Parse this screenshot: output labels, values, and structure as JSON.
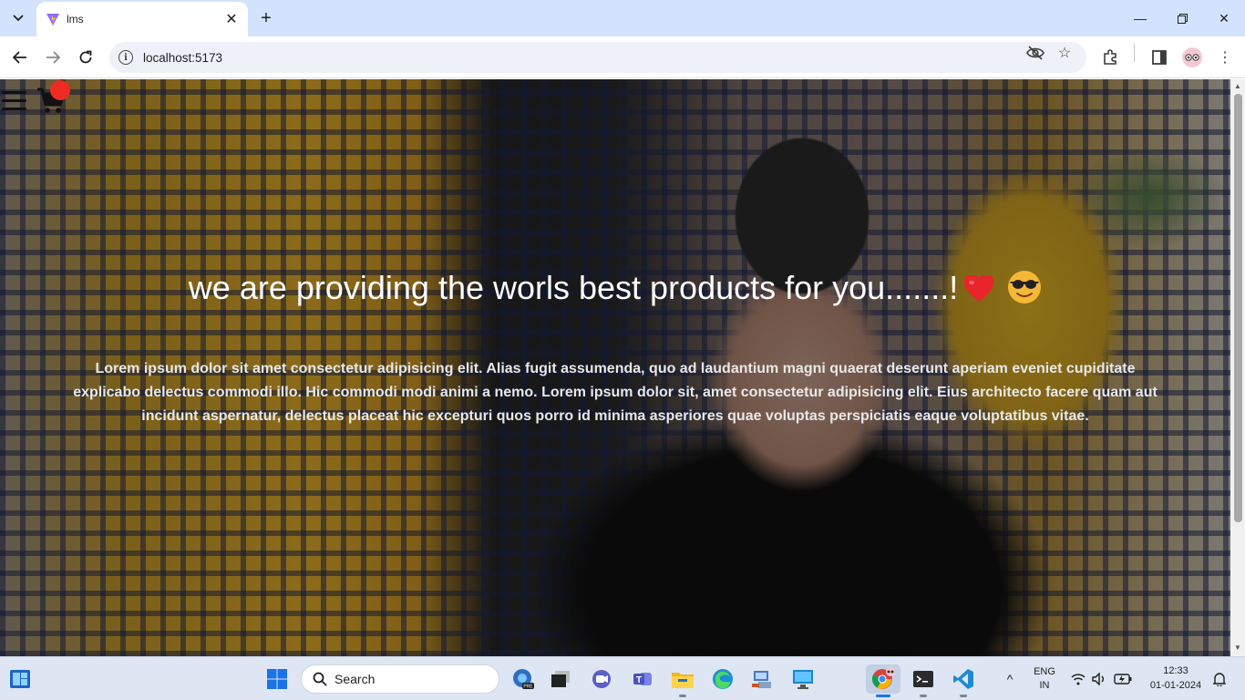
{
  "browser": {
    "tab_title": "lms",
    "url": "localhost:5173"
  },
  "page": {
    "headline": "we are providing the worls best products for you.......!",
    "body": "Lorem ipsum dolor sit amet consectetur adipisicing elit. Alias fugit assumenda, quo ad laudantium magni quaerat deserunt aperiam eveniet cupiditate explicabo delectus commodi illo. Hic commodi modi animi a nemo. Lorem ipsum dolor sit, amet consectetur adipisicing elit. Eius architecto facere quam aut incidunt aspernatur, delectus placeat hic excepturi quos porro id minima asperiores quae voluptas perspiciatis eaque voluptatibus vitae."
  },
  "taskbar": {
    "search_label": "Search",
    "lang": "ENG",
    "region": "IN",
    "time": "12:33",
    "date": "01-01-2024"
  },
  "colors": {
    "cart_badge": "#ee2b23",
    "tabstrip": "#d3e3fd",
    "taskbar": "#dde6f2"
  }
}
